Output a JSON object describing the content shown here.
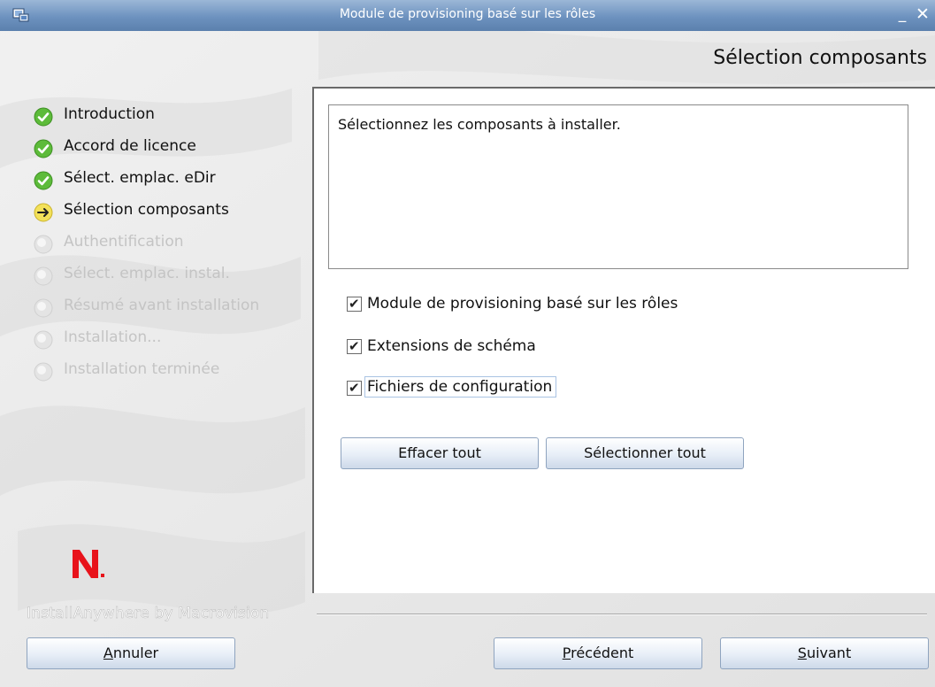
{
  "window": {
    "title": "Module de provisioning basé sur les rôles",
    "icon": "installer-window-icon",
    "minimize_glyph": "_",
    "close_glyph": "✕"
  },
  "page": {
    "heading": "Sélection composants"
  },
  "steps": [
    {
      "label": "Introduction",
      "state": "done"
    },
    {
      "label": "Accord de licence",
      "state": "done"
    },
    {
      "label": "Sélect. emplac. eDir",
      "state": "done"
    },
    {
      "label": "Sélection composants",
      "state": "active"
    },
    {
      "label": "Authentification",
      "state": "pending"
    },
    {
      "label": "Sélect. emplac. instal.",
      "state": "pending"
    },
    {
      "label": "Résumé avant installation",
      "state": "pending"
    },
    {
      "label": "Installation...",
      "state": "pending"
    },
    {
      "label": "Installation terminée",
      "state": "pending"
    }
  ],
  "branding": {
    "vendor": "InstallAnywhere by Macrovision",
    "logo_icon": "novell-n-logo",
    "logo_color": "#e8131b"
  },
  "content": {
    "description": "Sélectionnez les composants à installer.",
    "components": [
      {
        "label": "Module de provisioning basé sur les rôles",
        "checked": true
      },
      {
        "label": "Extensions de schéma",
        "checked": true
      },
      {
        "label": "Fichiers de configuration",
        "checked": true
      }
    ],
    "check_glyph": "✔",
    "clear_all_label": "Effacer tout",
    "select_all_label": "Sélectionner tout"
  },
  "footer": {
    "cancel": {
      "pre": "",
      "mnemonic": "A",
      "post": "nnuler"
    },
    "previous": {
      "pre": "",
      "mnemonic": "P",
      "post": "récédent"
    },
    "next": {
      "pre": "",
      "mnemonic": "S",
      "post": "uivant"
    }
  },
  "colors": {
    "titlebar": "#6d92bf",
    "done_check": "#5dbb3a",
    "active_arrow": "#f3e15a",
    "pending_dot": "#e4e4e4"
  }
}
